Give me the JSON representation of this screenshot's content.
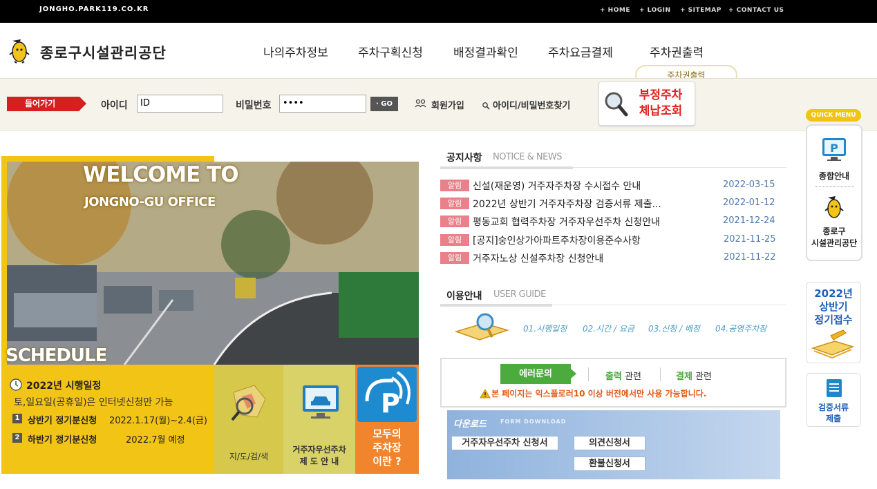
{
  "topbar": {
    "domain": "JONGHO.PARK119.CO.KR",
    "links": [
      "+ HOME",
      "+ LOGIN",
      "+ SITEMAP",
      "+ CONTACT US"
    ]
  },
  "header": {
    "logo_text": "종로구시설관리공단",
    "nav": [
      "나의주차정보",
      "주차구획신청",
      "배정결과확인",
      "주차요금결제",
      "주차권출력"
    ],
    "nav_tooltip": "주차권출력"
  },
  "login": {
    "enter_label": "들어가기",
    "id_label": "아이디",
    "id_value": "ID",
    "pw_label": "비밀번호",
    "pw_value": "••••",
    "go_label": "· GO",
    "join_label": "회원가입",
    "find_label": "아이디/비밀번호찾기",
    "illegal_line1": "부정주차",
    "illegal_line2": "체납조회"
  },
  "quick_menu": {
    "badge": "QUICK MENU",
    "item1": "종합안내",
    "item2_line1": "종로구",
    "item2_line2": "시설관리공단",
    "banner_2022_line1": "2022년",
    "banner_2022_line2": "상반기",
    "banner_2022_line3": "정기접수",
    "verify_line1": "검증서류",
    "verify_line2": "제출"
  },
  "hero": {
    "welcome1": "WELCOME TO",
    "welcome2": "JONGNO-GU OFFICE",
    "schedule_word": "SCHEDULE",
    "sched_title": "2022년 시행일정",
    "sched_note": "토,일요일(공휴일)은 인터넷신청만 가능",
    "item1_num": "1",
    "item1_label": "상반기 정기분신청",
    "item1_date": "2022.1.17(월)~2.4(금)",
    "item2_num": "2",
    "item2_label": "하반기 정기분신청",
    "item2_date": "2022.7월 예정",
    "tile_map": "지/도/검/색",
    "tile_resident_line1": "거주자우선주차",
    "tile_resident_line2": "제 도 안 내",
    "tile_modu_line1": "모두의",
    "tile_modu_line2": "주차장",
    "tile_modu_line3": "이란 ?"
  },
  "notice": {
    "title": "공지사항",
    "sub": "NOTICE & NEWS",
    "items": [
      {
        "badge": "알림",
        "title": "신설(재운영) 거주자주차장 수시접수 안내",
        "date": "2022-03-15"
      },
      {
        "badge": "알림",
        "title": "2022년 상반기 거주자주차장 검증서류 제출...",
        "date": "2022-01-12"
      },
      {
        "badge": "알림",
        "title": "평동교회 협력주차장 거주자우선주차 신청안내",
        "date": "2021-12-24"
      },
      {
        "badge": "알림",
        "title": "[공지]숭인상가아파트주차장이용준수사항",
        "date": "2021-11-25"
      },
      {
        "badge": "알림",
        "title": "거주자노상 신설주차장 신청안내",
        "date": "2021-11-22"
      }
    ]
  },
  "guide": {
    "title": "이용안내",
    "sub": "USER GUIDE",
    "items": [
      "01.시행일정",
      "02.시간 / 요금",
      "03.신청 / 배정",
      "04.공영주차장"
    ]
  },
  "error": {
    "btn": "에러문의",
    "out_strong": "출력",
    "out_rest": "관련",
    "pay_strong": "결제",
    "pay_rest": "관련",
    "warning": "본 페이지는 익스플로러10 이상 버전에서만 사용 가능합니다."
  },
  "download": {
    "title": "다운로드",
    "sub": "FORM DOWNLOAD",
    "btn1": "거주자우선주차 신청서",
    "btn2": "의견신청서",
    "btn3": "환불신청서"
  }
}
